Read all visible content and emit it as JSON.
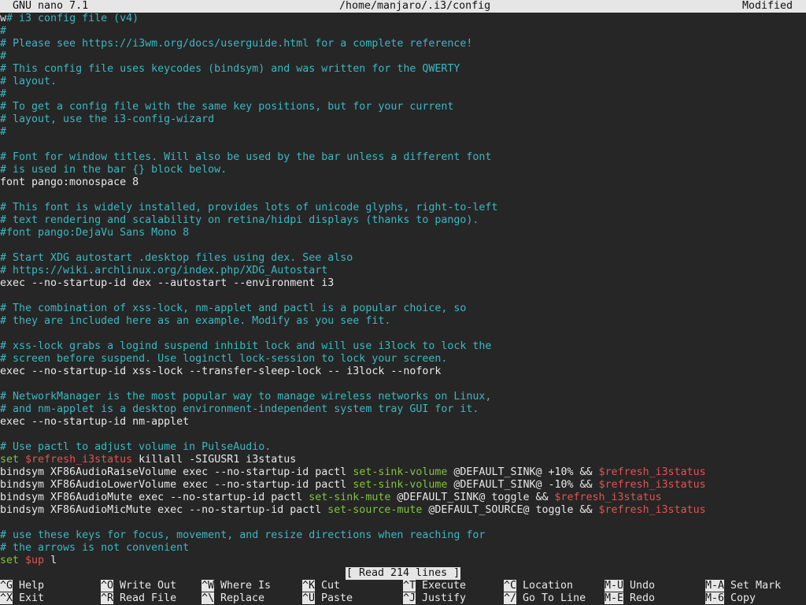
{
  "titlebar": {
    "app": "  GNU nano 7.1",
    "path": "/home/manjaro/.i3/config",
    "status": "Modified"
  },
  "lines": [
    {
      "t": "w# i3 config file (v4)"
    },
    {
      "t": "#"
    },
    {
      "t": "# Please see https://i3wm.org/docs/userguide.html for a complete reference!"
    },
    {
      "t": "#"
    },
    {
      "t": "# This config file uses keycodes (bindsym) and was written for the QWERTY"
    },
    {
      "t": "# layout."
    },
    {
      "t": "#"
    },
    {
      "t": "# To get a config file with the same key positions, but for your current"
    },
    {
      "t": "# layout, use the i3-config-wizard"
    },
    {
      "t": "#"
    },
    {
      "t": ""
    },
    {
      "t": "# Font for window titles. Will also be used by the bar unless a different font"
    },
    {
      "t": "# is used in the bar {} block below."
    },
    {
      "t": "font pango:monospace 8"
    },
    {
      "t": ""
    },
    {
      "t": "# This font is widely installed, provides lots of unicode glyphs, right-to-left"
    },
    {
      "t": "# text rendering and scalability on retina/hidpi displays (thanks to pango)."
    },
    {
      "t": "#font pango:DejaVu Sans Mono 8"
    },
    {
      "t": ""
    },
    {
      "t": "# Start XDG autostart .desktop files using dex. See also"
    },
    {
      "t": "# https://wiki.archlinux.org/index.php/XDG_Autostart"
    },
    {
      "t": "exec --no-startup-id dex --autostart --environment i3"
    },
    {
      "t": ""
    },
    {
      "t": "# The combination of xss-lock, nm-applet and pactl is a popular choice, so"
    },
    {
      "t": "# they are included here as an example. Modify as you see fit."
    },
    {
      "t": ""
    },
    {
      "t": "# xss-lock grabs a logind suspend inhibit lock and will use i3lock to lock the"
    },
    {
      "t": "# screen before suspend. Use loginctl lock-session to lock your screen."
    },
    {
      "t": "exec --no-startup-id xss-lock --transfer-sleep-lock -- i3lock --nofork"
    },
    {
      "t": ""
    },
    {
      "t": "# NetworkManager is the most popular way to manage wireless networks on Linux,"
    },
    {
      "t": "# and nm-applet is a desktop environment-independent system tray GUI for it."
    },
    {
      "t": "exec --no-startup-id nm-applet"
    },
    {
      "t": ""
    },
    {
      "t": "# Use pactl to adjust volume in PulseAudio."
    },
    {
      "t": "set $refresh_i3status killall -SIGUSR1 i3status"
    },
    {
      "t": "bindsym XF86AudioRaiseVolume exec --no-startup-id pactl set-sink-volume @DEFAULT_SINK@ +10% && $refresh_i3status"
    },
    {
      "t": "bindsym XF86AudioLowerVolume exec --no-startup-id pactl set-sink-volume @DEFAULT_SINK@ -10% && $refresh_i3status"
    },
    {
      "t": "bindsym XF86AudioMute exec --no-startup-id pactl set-sink-mute @DEFAULT_SINK@ toggle && $refresh_i3status"
    },
    {
      "t": "bindsym XF86AudioMicMute exec --no-startup-id pactl set-source-mute @DEFAULT_SOURCE@ toggle && $refresh_i3status"
    },
    {
      "t": ""
    },
    {
      "t": "# use these keys for focus, movement, and resize directions when reaching for"
    },
    {
      "t": "# the arrows is not convenient"
    },
    {
      "t": "set $up l"
    }
  ],
  "message": "[ Read 214 lines ]",
  "shortcuts": [
    [
      {
        "key": "^G",
        "label": "Help"
      },
      {
        "key": "^O",
        "label": "Write Out"
      },
      {
        "key": "^W",
        "label": "Where Is"
      },
      {
        "key": "^K",
        "label": "Cut"
      },
      {
        "key": "^T",
        "label": "Execute"
      },
      {
        "key": "^C",
        "label": "Location"
      },
      {
        "key": "M-U",
        "label": "Undo"
      },
      {
        "key": "M-A",
        "label": "Set Mark"
      }
    ],
    [
      {
        "key": "^X",
        "label": "Exit"
      },
      {
        "key": "^R",
        "label": "Read File"
      },
      {
        "key": "^\\",
        "label": "Replace"
      },
      {
        "key": "^U",
        "label": "Paste"
      },
      {
        "key": "^J",
        "label": "Justify"
      },
      {
        "key": "^/",
        "label": "Go To Line"
      },
      {
        "key": "M-E",
        "label": "Redo"
      },
      {
        "key": "M-6",
        "label": "Copy"
      }
    ]
  ],
  "colors": {
    "comment": "#3bb8c2",
    "keyword": "#7fc341",
    "variable": "#e05353",
    "background": "#262626",
    "bar": "#e6e6e6"
  }
}
